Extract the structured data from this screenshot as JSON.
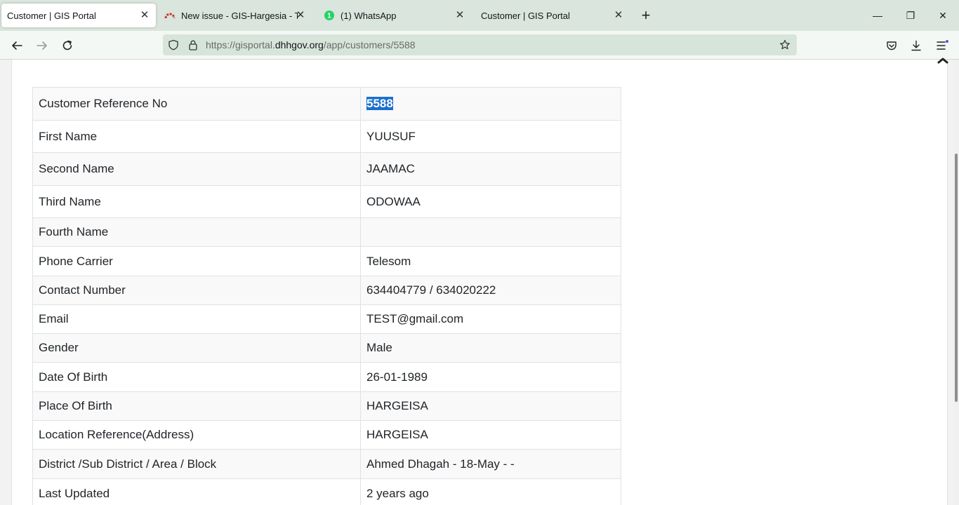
{
  "browser": {
    "tabs": [
      {
        "label": "Customer | GIS Portal",
        "active": true
      },
      {
        "label": "New issue - GIS-Hargesia - Team",
        "active": false
      },
      {
        "label": "(1) WhatsApp",
        "active": false,
        "badge": "1"
      },
      {
        "label": "Customer | GIS Portal",
        "active": false
      }
    ],
    "close_glyph": "✕",
    "new_tab_glyph": "+",
    "url_prefix": "https://gisportal.",
    "url_domain": "dhhgov.org",
    "url_path": "/app/customers/5588",
    "window_controls": {
      "minimize": "—",
      "restore": "❐",
      "close": "✕"
    }
  },
  "icons": [
    "back-icon",
    "forward-icon",
    "reload-icon",
    "shield-icon",
    "lock-icon",
    "star-icon",
    "pocket-icon",
    "download-icon",
    "menu-icon",
    "chevron-up-icon"
  ],
  "colors": {
    "tabstrip_bg": "#d9e5dd",
    "urlbar_bg": "#d7e4da",
    "selection": "#1a6fce"
  },
  "customer": {
    "rows": [
      {
        "label": "Customer Reference No",
        "value": "5588"
      },
      {
        "label": "First Name",
        "value": "YUUSUF"
      },
      {
        "label": "Second Name",
        "value": "JAAMAC"
      },
      {
        "label": "Third Name",
        "value": "ODOWAA"
      },
      {
        "label": "Fourth Name",
        "value": ""
      },
      {
        "label": "Phone Carrier",
        "value": "Telesom"
      },
      {
        "label": "Contact Number",
        "value": "634404779 / 634020222"
      },
      {
        "label": "Email",
        "value": "TEST@gmail.com"
      },
      {
        "label": "Gender",
        "value": "Male"
      },
      {
        "label": "Date Of Birth",
        "value": "26-01-1989"
      },
      {
        "label": "Place Of Birth",
        "value": "HARGEISA"
      },
      {
        "label": "Location Reference(Address)",
        "value": "HARGEISA"
      },
      {
        "label": "District /Sub District / Area / Block",
        "value": "Ahmed Dhagah - 18-May - -"
      },
      {
        "label": "Last Updated",
        "value": "2 years ago"
      }
    ]
  }
}
